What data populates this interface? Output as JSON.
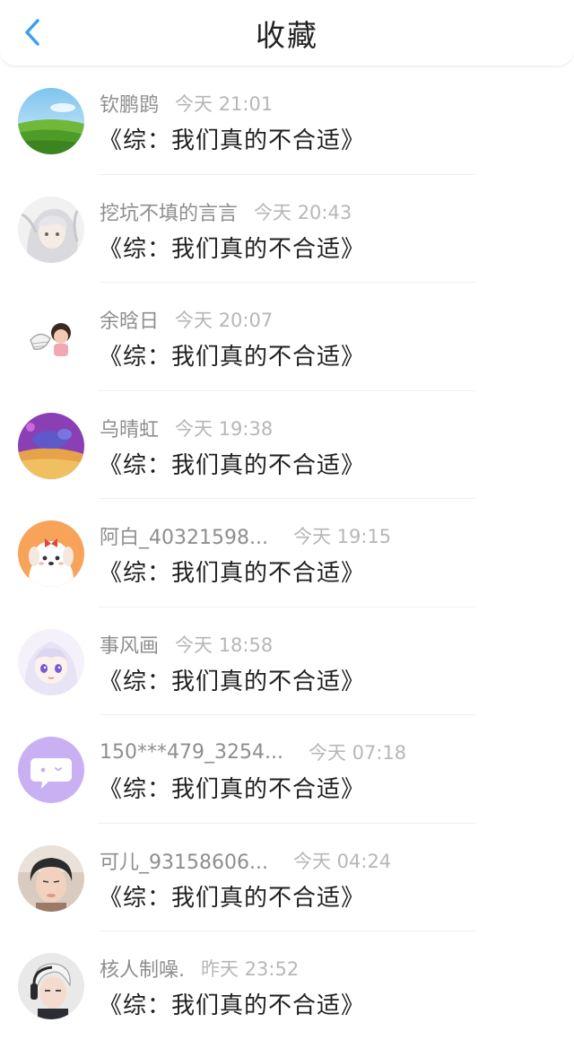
{
  "header": {
    "title": "收藏",
    "back_icon": "chevron-left-icon",
    "accent": "#3a9ef2"
  },
  "items": [
    {
      "name": "钦鹏鹍",
      "time": "今天 21:01",
      "book": "《综：我们真的不合适》",
      "avatar": "landscape-field"
    },
    {
      "name": "挖坑不填的言言",
      "time": "今天 20:43",
      "book": "《综：我们真的不合适》",
      "avatar": "anime-white-hair-girl"
    },
    {
      "name": "余晗日",
      "time": "今天 20:07",
      "book": "《综：我们真的不合适》",
      "avatar": "cartoon-couple"
    },
    {
      "name": "乌晴虹",
      "time": "今天 19:38",
      "book": "《综：我们真的不合适》",
      "avatar": "purple-painting"
    },
    {
      "name": "阿白_40321598...",
      "time": "今天 19:15",
      "book": "《综：我们真的不合适》",
      "avatar": "cute-dog"
    },
    {
      "name": "事风画",
      "time": "今天 18:58",
      "book": "《综：我们真的不合适》",
      "avatar": "anime-purple-eyes"
    },
    {
      "name": "150***479_3254...",
      "time": "今天 07:18",
      "book": "《综：我们真的不合适》",
      "avatar": "chat-bubble-default"
    },
    {
      "name": "可儿_93158606...",
      "time": "今天 04:24",
      "book": "《综：我们真的不合适》",
      "avatar": "photo-person"
    },
    {
      "name": "核人制噪.",
      "time": "昨天 23:52",
      "book": "《综：我们真的不合适》",
      "avatar": "anime-boy-headphones"
    }
  ]
}
